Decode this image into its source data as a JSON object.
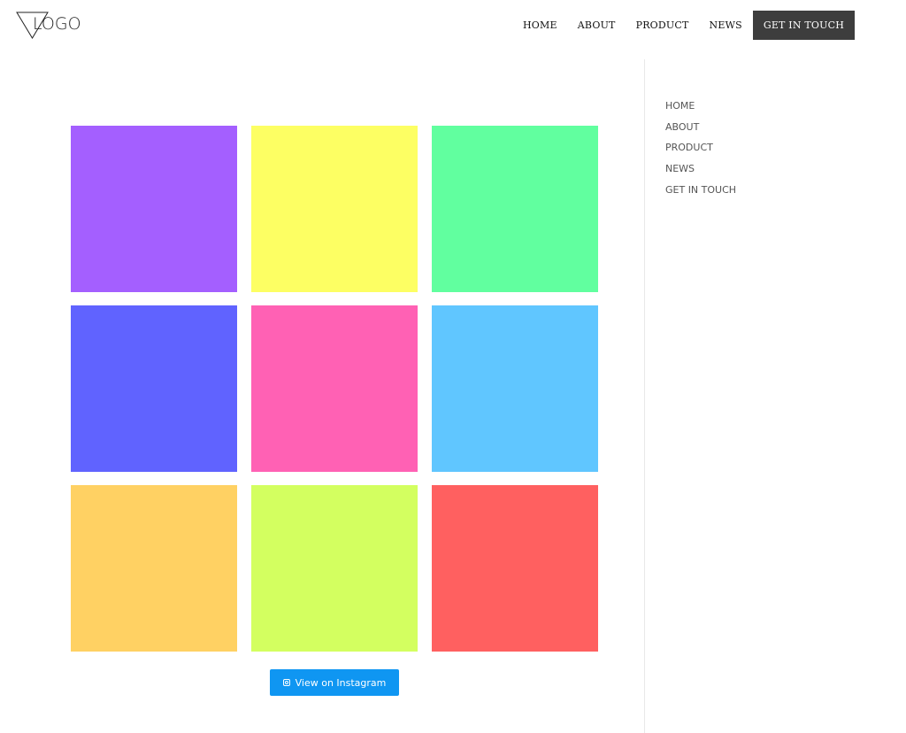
{
  "brand": {
    "logo_text": "LOGO"
  },
  "header": {
    "nav": [
      "HOME",
      "ABOUT",
      "PRODUCT",
      "NEWS"
    ],
    "cta_label": "GET IN TOUCH"
  },
  "gallery": {
    "tiles": [
      {
        "color": "#a45fff"
      },
      {
        "color": "#fdff63"
      },
      {
        "color": "#61ff9f"
      },
      {
        "color": "#6063ff"
      },
      {
        "color": "#ff61b4"
      },
      {
        "color": "#60c6ff"
      },
      {
        "color": "#ffd163"
      },
      {
        "color": "#d3ff60"
      },
      {
        "color": "#ff6060"
      }
    ],
    "button_label": "View on Instagram",
    "button_color": "#0f96f2"
  },
  "sidebar": {
    "items": [
      "HOME",
      "ABOUT",
      "PRODUCT",
      "NEWS",
      "GET IN TOUCH"
    ]
  }
}
